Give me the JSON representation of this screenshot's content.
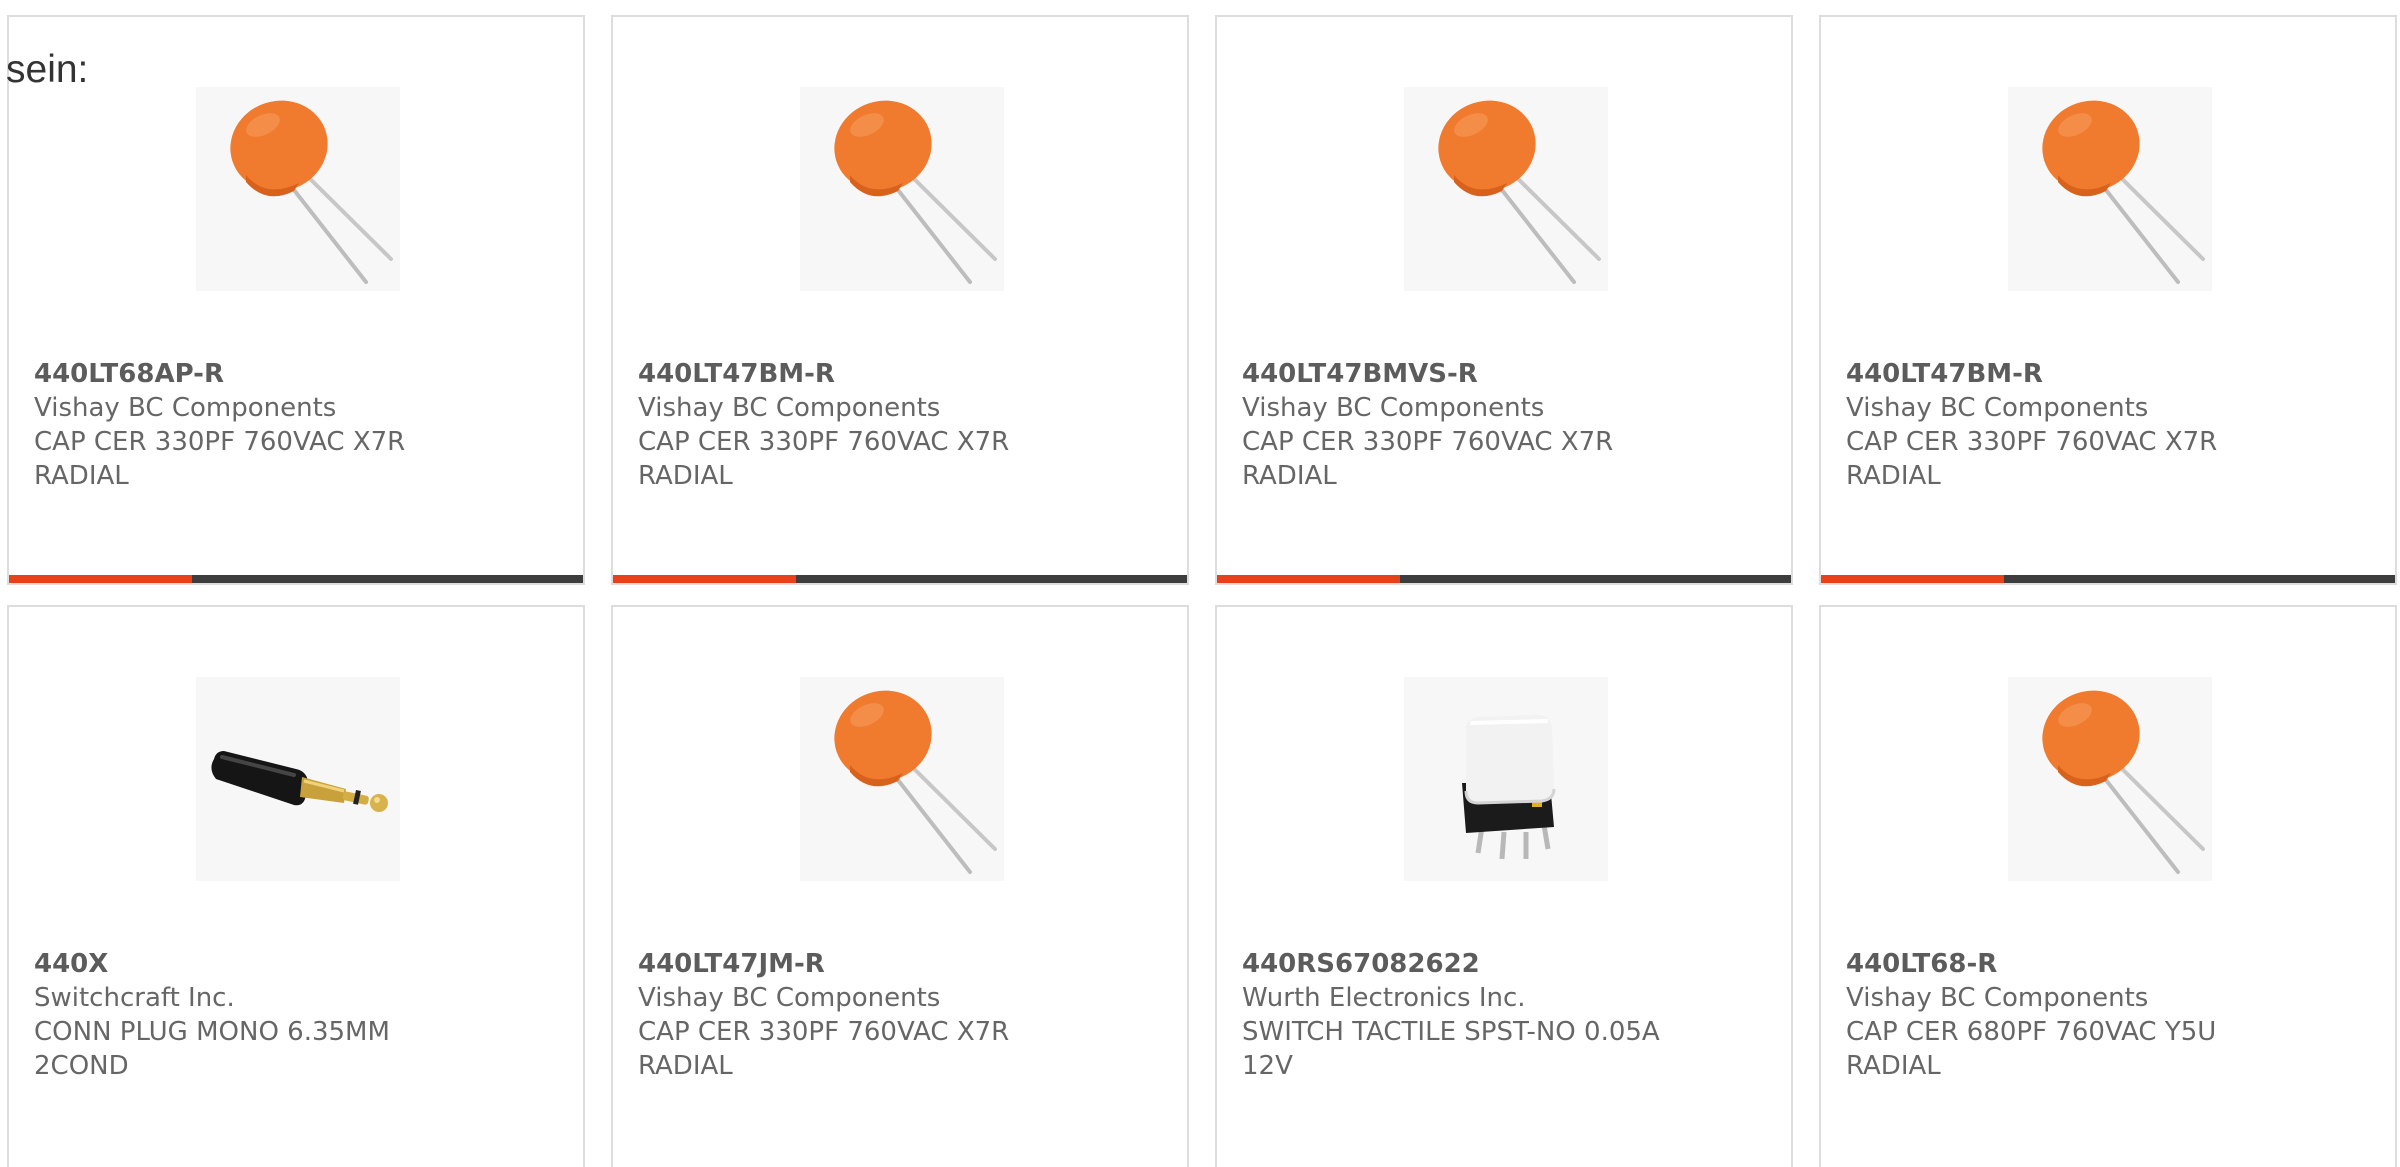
{
  "intro_text": "sein:",
  "colors": {
    "accent": "#e8411a",
    "bar_dark": "#3d3d3d",
    "capacitor_orange": "#f07a2e",
    "card_border": "#dddddd"
  },
  "cards": [
    {
      "part_number": "440LT68AP-R",
      "manufacturer": "Vishay BC Components",
      "description": "CAP CER 330PF 760VAC X7R RADIAL",
      "image_icon": "ceramic-disc-capacitor-icon"
    },
    {
      "part_number": "440LT47BM-R",
      "manufacturer": "Vishay BC Components",
      "description": "CAP CER 330PF 760VAC X7R RADIAL",
      "image_icon": "ceramic-disc-capacitor-icon"
    },
    {
      "part_number": "440LT47BMVS-R",
      "manufacturer": "Vishay BC Components",
      "description": "CAP CER 330PF 760VAC X7R RADIAL",
      "image_icon": "ceramic-disc-capacitor-icon"
    },
    {
      "part_number": "440LT47BM-R",
      "manufacturer": "Vishay BC Components",
      "description": "CAP CER 330PF 760VAC X7R RADIAL",
      "image_icon": "ceramic-disc-capacitor-icon"
    },
    {
      "part_number": "440X",
      "manufacturer": "Switchcraft Inc.",
      "description": "CONN PLUG MONO 6.35MM 2COND",
      "image_icon": "mono-plug-connector-icon"
    },
    {
      "part_number": "440LT47JM-R",
      "manufacturer": "Vishay BC Components",
      "description": "CAP CER 330PF 760VAC X7R RADIAL",
      "image_icon": "ceramic-disc-capacitor-icon"
    },
    {
      "part_number": "440RS67082622",
      "manufacturer": "Wurth Electronics Inc.",
      "description": "SWITCH TACTILE SPST-NO 0.05A 12V",
      "image_icon": "tactile-switch-icon"
    },
    {
      "part_number": "440LT68-R",
      "manufacturer": "Vishay BC Components",
      "description": "CAP CER 680PF 760VAC Y5U RADIAL",
      "image_icon": "ceramic-disc-capacitor-icon"
    }
  ]
}
